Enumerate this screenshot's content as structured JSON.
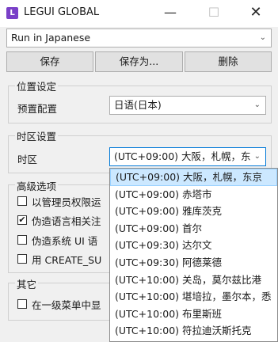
{
  "window": {
    "title": "LEGUI GLOBAL",
    "app_icon_letter": "L",
    "minimize": "—",
    "maximize": "☐",
    "close": "✕"
  },
  "profile_select": {
    "value": "Run in Japanese",
    "arrow": "⌄"
  },
  "buttons": {
    "save": "保存",
    "save_as": "保存为...",
    "delete": "删除"
  },
  "location": {
    "group_label": "位置设定",
    "preset_label": "预置配置",
    "preset_value": "日语(日本)",
    "arrow": "⌄"
  },
  "timezone": {
    "group_label": "时区设置",
    "field_label": "时区",
    "current_value": "(UTC+09:00) 大阪，札幌，东",
    "arrow": "⌄",
    "options": [
      "(UTC+09:00) 大阪，札幌，东京",
      "(UTC+09:00) 赤塔市",
      "(UTC+09:00) 雅库茨克",
      "(UTC+09:00) 首尔",
      "(UTC+09:30) 达尔文",
      "(UTC+09:30) 阿德莱德",
      "(UTC+10:00) 关岛，莫尔兹比港",
      "(UTC+10:00) 堪培拉，墨尔本，悉",
      "(UTC+10:00) 布里斯班",
      "(UTC+10:00) 符拉迪沃斯托克"
    ]
  },
  "advanced": {
    "group_label": "高级选项",
    "options": [
      {
        "label": "以管理员权限运",
        "checked": false
      },
      {
        "label": "伪造语言相关注",
        "checked": true
      },
      {
        "label": "伪造系统 UI 语",
        "checked": false
      },
      {
        "label": "用 CREATE_SU",
        "checked": false
      }
    ]
  },
  "other": {
    "group_label": "其它",
    "options": [
      {
        "label": "在一级菜单中显",
        "checked": false
      }
    ]
  }
}
